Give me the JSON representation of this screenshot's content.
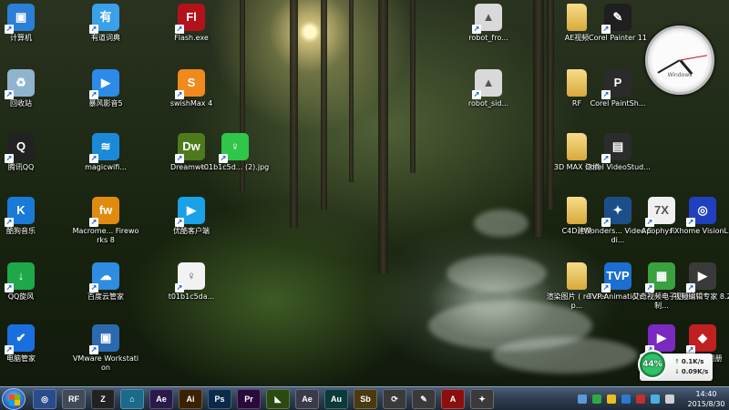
{
  "desktop": {
    "icons": [
      {
        "label": "计算机",
        "icon": "computer-icon",
        "color": "#2c7fd6",
        "glyph": "▣"
      },
      {
        "label": "有道词典",
        "icon": "youdao-dict-icon",
        "color": "#3aa0e8",
        "glyph": "有"
      },
      {
        "label": "Flash.exe",
        "icon": "flash-icon",
        "color": "#b3121b",
        "glyph": "Fl"
      },
      {
        "label": "robot_fro...",
        "icon": "robot-image-icon",
        "color": "#d9d9d9",
        "glyph": "▲"
      },
      {
        "label": "AE视频",
        "icon": "folder-icon",
        "color": "",
        "glyph": ""
      },
      {
        "label": "Corel Painter 11",
        "icon": "corel-painter-icon",
        "color": "#1f1f1f",
        "glyph": "✎"
      },
      {
        "label": "回收站",
        "icon": "recycle-bin-icon",
        "color": "#8fb4cf",
        "glyph": "♻"
      },
      {
        "label": "暴风影音5",
        "icon": "baofeng-icon",
        "color": "#2c8ae8",
        "glyph": "▶"
      },
      {
        "label": "swishMax 4",
        "icon": "swishmax-icon",
        "color": "#f08a1d",
        "glyph": "S"
      },
      {
        "label": "robot_sid...",
        "icon": "robot-image-icon",
        "color": "#d9d9d9",
        "glyph": "▲"
      },
      {
        "label": "RF",
        "icon": "folder-icon",
        "color": "",
        "glyph": ""
      },
      {
        "label": "Corel PaintSh...",
        "icon": "corel-paintshop-icon",
        "color": "#2b2b2b",
        "glyph": "P"
      },
      {
        "label": "腾讯QQ",
        "icon": "qq-icon",
        "color": "#222222",
        "glyph": "Q"
      },
      {
        "label": "magicwifi...",
        "icon": "wifi-icon",
        "color": "#1a8ad8",
        "glyph": "≋"
      },
      {
        "label": "Dreamwe...",
        "icon": "dreamweaver-icon",
        "color": "#4d7b1c",
        "glyph": "Dw"
      },
      {
        "label": "t01b1c5d... (2).jpg",
        "icon": "image-file-icon",
        "color": "#2fc64a",
        "glyph": "♀"
      },
      {
        "label": "3D MAX 建模",
        "icon": "folder-icon",
        "color": "",
        "glyph": ""
      },
      {
        "label": "Corel VideoStud...",
        "icon": "corel-videostudio-icon",
        "color": "#2c2c2c",
        "glyph": "▤"
      },
      {
        "label": "酷狗音乐",
        "icon": "kugou-icon",
        "color": "#1a7ad8",
        "glyph": "K"
      },
      {
        "label": "Macrome... Fireworks 8",
        "icon": "fireworks-icon",
        "color": "#e08a10",
        "glyph": "fw"
      },
      {
        "label": "优酷客户端",
        "icon": "youku-icon",
        "color": "#1aa1e8",
        "glyph": "▶"
      },
      {
        "label": "C4D建模",
        "icon": "folder-icon",
        "color": "",
        "glyph": ""
      },
      {
        "label": "Wonders... Video Edi...",
        "icon": "wondershare-icon",
        "color": "#1c4f8a",
        "glyph": "✦"
      },
      {
        "label": "Apophysi...",
        "icon": "apophysis-icon",
        "color": "#f0f0f0",
        "glyph": "7X"
      },
      {
        "label": "FXhome VisionL...",
        "icon": "fxhome-icon",
        "color": "#2040c0",
        "glyph": "◎"
      },
      {
        "label": "QQ旋风",
        "icon": "qq-whirlwind-icon",
        "color": "#1fa84a",
        "glyph": "↓"
      },
      {
        "label": "百度云管家",
        "icon": "baidu-cloud-icon",
        "color": "#2e8de0",
        "glyph": "☁"
      },
      {
        "label": "t01b1c5da...",
        "icon": "image-file-icon",
        "color": "#f2f2f2",
        "glyph": "♀"
      },
      {
        "label": "渲染图片 ( render p...",
        "icon": "folder-icon",
        "color": "",
        "glyph": ""
      },
      {
        "label": "TVP Animation...",
        "icon": "tvp-animation-icon",
        "color": "#1a6fd0",
        "glyph": "TVP"
      },
      {
        "label": "艾奇视频电子相册制...",
        "icon": "photo-album-icon",
        "color": "#3aa040",
        "glyph": "▦"
      },
      {
        "label": "视频编辑专家 8.2",
        "icon": "video-editor-icon",
        "color": "#3a3a3a",
        "glyph": "▶"
      },
      {
        "label": "电脑管家",
        "icon": "pc-manager-icon",
        "color": "#1a6fe0",
        "glyph": "✔"
      },
      {
        "label": "VMware Workstation",
        "icon": "vmware-icon",
        "color": "#2c6ab0",
        "glyph": "▣"
      },
      {
        "label": "",
        "icon": "video-album-icon",
        "color": "#7a2ac0",
        "glyph": "▶"
      },
      {
        "label": "滤镜3D相册",
        "icon": "filter-3d-album-icon",
        "color": "#c02020",
        "glyph": "◆"
      }
    ]
  },
  "clock_widget": {
    "brand": "Windows",
    "time": "14:40"
  },
  "net_monitor": {
    "percent": "44%",
    "upload": "0.1K/s",
    "download": "0.09K/s"
  },
  "taskbar": {
    "start_icon": "windows-start-icon",
    "apps": [
      {
        "icon": "browser-icon",
        "label": "◎",
        "color": "#2a4c8a"
      },
      {
        "icon": "rf-icon",
        "label": "RF",
        "color": "#404a58"
      },
      {
        "icon": "zbrush-icon",
        "label": "Z",
        "color": "#222222"
      },
      {
        "icon": "app-icon",
        "label": "⌂",
        "color": "#1a6a8a"
      },
      {
        "icon": "after-effects-icon",
        "label": "Ae",
        "color": "#2a1a4a"
      },
      {
        "icon": "illustrator-icon",
        "label": "Ai",
        "color": "#3a2200"
      },
      {
        "icon": "photoshop-icon",
        "label": "Ps",
        "color": "#0a2a4a"
      },
      {
        "icon": "premiere-icon",
        "label": "Pr",
        "color": "#2a0a3a"
      },
      {
        "icon": "nvidia-icon",
        "label": "◣",
        "color": "#2a4a10"
      },
      {
        "icon": "after-effects-icon",
        "label": "Ae",
        "color": "#3a3a4a"
      },
      {
        "icon": "audition-icon",
        "label": "Au",
        "color": "#0a3a3a"
      },
      {
        "icon": "soundbooth-icon",
        "label": "Sb",
        "color": "#4a3a10"
      },
      {
        "icon": "app-icon",
        "label": "⟳",
        "color": "#3a3a3a"
      },
      {
        "icon": "app-icon",
        "label": "✎",
        "color": "#3a3a3a"
      },
      {
        "icon": "autocad-icon",
        "label": "A",
        "color": "#8a1010"
      },
      {
        "icon": "app-icon",
        "label": "✦",
        "color": "#3a3a3a"
      }
    ],
    "tray": {
      "time": "14:40",
      "date": "2015/8/30"
    }
  }
}
